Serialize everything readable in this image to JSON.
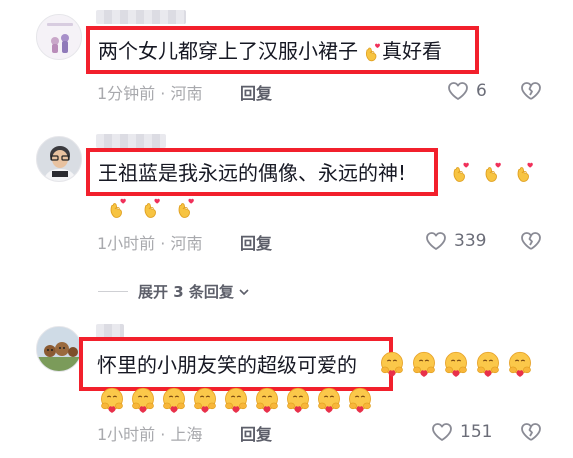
{
  "comments": [
    {
      "text": "两个女儿都穿上了汉服小裙子",
      "suffix": "真好看",
      "time": "1分钟前",
      "location": "河南",
      "reply_label": "回复",
      "likes": "6"
    },
    {
      "text": "王祖蓝是我永远的偶像、永远的神!",
      "time": "1小时前",
      "location": "河南",
      "reply_label": "回复",
      "likes": "339"
    },
    {
      "text": "怀里的小朋友笑的超级可爱的",
      "time": "1小时前",
      "location": "上海",
      "reply_label": "回复",
      "likes": "151"
    }
  ],
  "expand_replies": "展开 3 条回复",
  "separator": "·",
  "colors": {
    "highlight": "#f2202c",
    "meta": "#a8a9ad"
  },
  "icons": [
    "heart-outline-icon",
    "broken-heart-icon",
    "finger-heart-emoji",
    "hug-face-emoji",
    "chevron-down-icon"
  ]
}
